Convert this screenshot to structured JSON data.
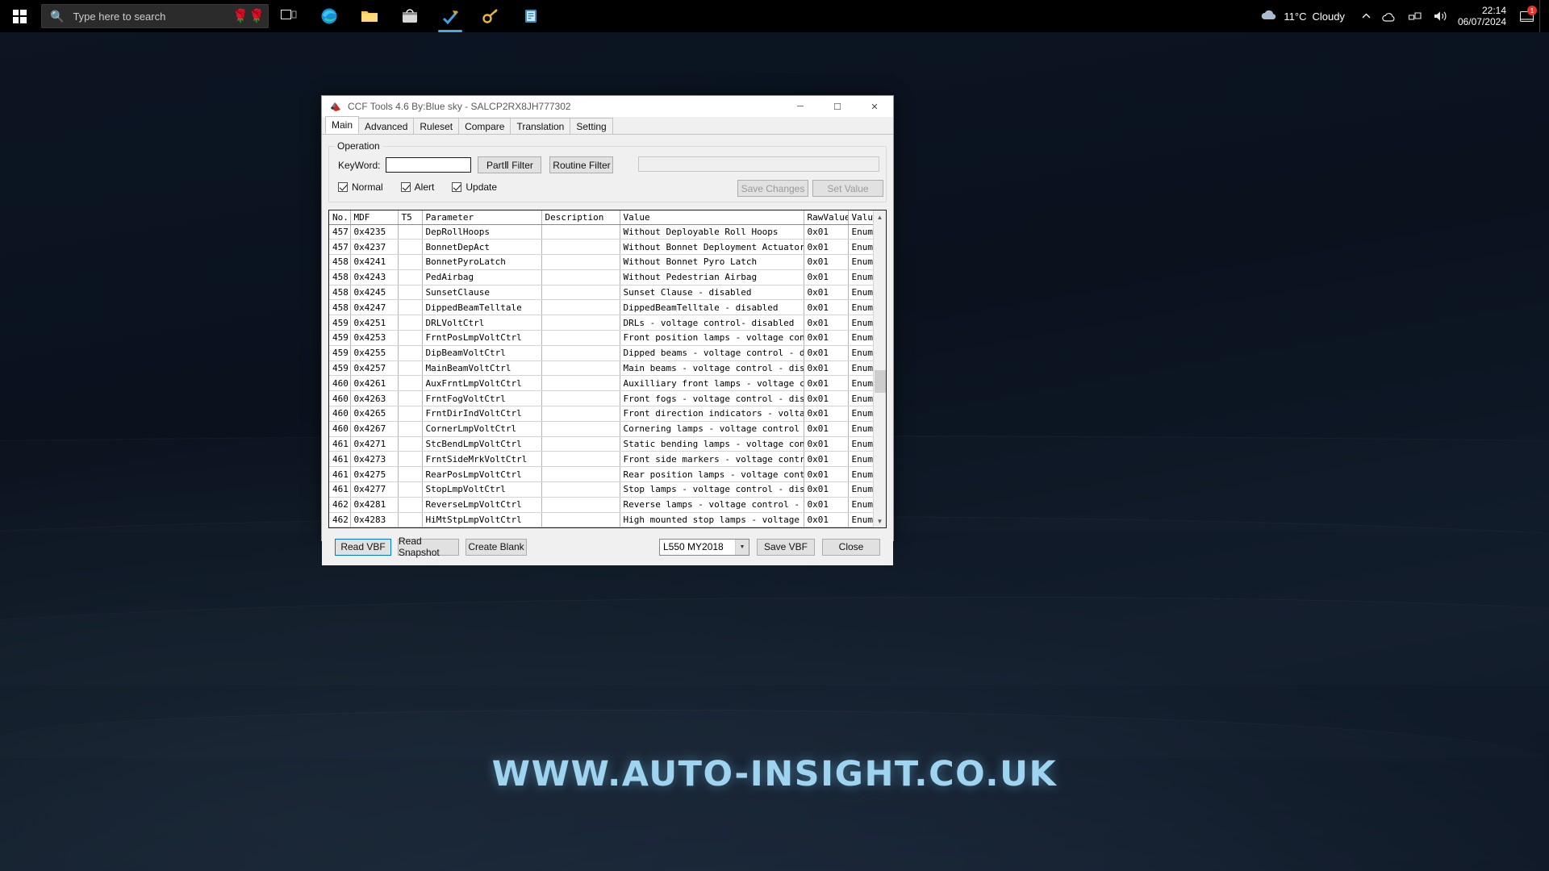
{
  "taskbar": {
    "start_icon": "windows-logo-icon",
    "search_placeholder": "Type here to search",
    "search_value": "",
    "search_icon": "search-icon",
    "decor_icon": "rose-icon",
    "pinned": [
      {
        "name": "task-view-icon",
        "glyph": "▢"
      },
      {
        "name": "microsoft-edge-icon",
        "glyph": "e"
      },
      {
        "name": "file-explorer-icon",
        "glyph": "🗀"
      },
      {
        "name": "microsoft-store-icon",
        "glyph": "🛍"
      },
      {
        "name": "app-pinned-icon-1",
        "glyph": "✓"
      },
      {
        "name": "app-pinned-icon-2",
        "glyph": "🔑"
      },
      {
        "name": "app-pinned-icon-3",
        "glyph": "📋"
      }
    ],
    "weather_temp": "11°C",
    "weather_desc": "Cloudy",
    "weather_icon": "cloud-icon",
    "tray_icons": [
      {
        "name": "show-hidden-icons-chevron",
        "glyph": "⌃"
      },
      {
        "name": "onedrive-icon",
        "glyph": "☁"
      },
      {
        "name": "network-icon",
        "glyph": "🖧"
      },
      {
        "name": "volume-icon",
        "glyph": "🔊"
      }
    ],
    "notification_badge": "1",
    "clock_time": "22:14",
    "clock_date": "06/07/2024"
  },
  "desktop": {
    "watermark": "WWW.AUTO-INSIGHT.CO.UK"
  },
  "window": {
    "title": "CCF Tools 4.6  By:Blue sky - SALCP2RX8JH777302",
    "app_icon": "ccf-tools-icon",
    "minimize": "─",
    "maximize": "☐",
    "close": "✕"
  },
  "tabs": [
    {
      "label": "Main",
      "selected": true
    },
    {
      "label": "Advanced",
      "selected": false
    },
    {
      "label": "Ruleset",
      "selected": false
    },
    {
      "label": "Compare",
      "selected": false
    },
    {
      "label": "Translation",
      "selected": false
    },
    {
      "label": "Setting",
      "selected": false
    }
  ],
  "operation": {
    "legend": "Operation",
    "keyword_label": "KeyWord:",
    "keyword_value": "",
    "keyword_placeholder": "",
    "partii_filter": "PartⅡ Filter",
    "routine_filter": "Routine Filter",
    "status_value": "",
    "save_changes": "Save Changes",
    "set_value": "Set Value",
    "checkboxes": [
      {
        "label": "Normal",
        "checked": true
      },
      {
        "label": "Alert",
        "checked": true
      },
      {
        "label": "Update",
        "checked": true
      }
    ]
  },
  "grid": {
    "columns": [
      "No.",
      "MDF",
      "T5",
      "Parameter",
      "Description",
      "Value",
      "RawValue",
      "ValueType"
    ],
    "rows": [
      [
        "457",
        "0x4235",
        "",
        "DepRollHoops",
        "",
        "Without Deployable Roll Hoops",
        "0x01",
        "Enumerated"
      ],
      [
        "457",
        "0x4237",
        "",
        "BonnetDepAct",
        "",
        "Without Bonnet Deployment Actuator",
        "0x01",
        "Enumerated"
      ],
      [
        "458",
        "0x4241",
        "",
        "BonnetPyroLatch",
        "",
        "Without Bonnet Pyro Latch",
        "0x01",
        "Enumerated"
      ],
      [
        "458",
        "0x4243",
        "",
        "PedAirbag",
        "",
        "Without Pedestrian Airbag",
        "0x01",
        "Enumerated"
      ],
      [
        "458",
        "0x4245",
        "",
        "SunsetClause",
        "",
        "Sunset Clause - disabled",
        "0x01",
        "Enumerated"
      ],
      [
        "458",
        "0x4247",
        "",
        "DippedBeamTelltale",
        "",
        "DippedBeamTelltale - disabled",
        "0x01",
        "Enumerated"
      ],
      [
        "459",
        "0x4251",
        "",
        "DRLVoltCtrl",
        "",
        "DRLs - voltage control- disabled",
        "0x01",
        "Enumerated"
      ],
      [
        "459",
        "0x4253",
        "",
        "FrntPosLmpVoltCtrl",
        "",
        "Front position lamps - voltage control - d...",
        "0x01",
        "Enumerated"
      ],
      [
        "459",
        "0x4255",
        "",
        "DipBeamVoltCtrl",
        "",
        "Dipped beams - voltage control - disabled",
        "0x01",
        "Enumerated"
      ],
      [
        "459",
        "0x4257",
        "",
        "MainBeamVoltCtrl",
        "",
        "Main beams - voltage control - disabled",
        "0x01",
        "Enumerated"
      ],
      [
        "460",
        "0x4261",
        "",
        "AuxFrntLmpVoltCtrl",
        "",
        "Auxilliary front lamps - voltage control -...",
        "0x01",
        "Enumerated"
      ],
      [
        "460",
        "0x4263",
        "",
        "FrntFogVoltCtrl",
        "",
        "Front fogs - voltage control - disabled",
        "0x01",
        "Enumerated"
      ],
      [
        "460",
        "0x4265",
        "",
        "FrntDirIndVoltCtrl",
        "",
        "Front direction indicators - voltage contr...",
        "0x01",
        "Enumerated"
      ],
      [
        "460",
        "0x4267",
        "",
        "CornerLmpVoltCtrl",
        "",
        "Cornering lamps - voltage control - disabled",
        "0x01",
        "Enumerated"
      ],
      [
        "461",
        "0x4271",
        "",
        "StcBendLmpVoltCtrl",
        "",
        "Static bending lamps - voltage control - d...",
        "0x01",
        "Enumerated"
      ],
      [
        "461",
        "0x4273",
        "",
        "FrntSideMrkVoltCtrl",
        "",
        "Front side markers - voltage control - dis...",
        "0x01",
        "Enumerated"
      ],
      [
        "461",
        "0x4275",
        "",
        "RearPosLmpVoltCtrl",
        "",
        "Rear position lamps - voltage control - di...",
        "0x01",
        "Enumerated"
      ],
      [
        "461",
        "0x4277",
        "",
        "StopLmpVoltCtrl",
        "",
        "Stop lamps - voltage control - disabled",
        "0x01",
        "Enumerated"
      ],
      [
        "462",
        "0x4281",
        "",
        "ReverseLmpVoltCtrl",
        "",
        "Reverse lamps - voltage control - disabled",
        "0x01",
        "Enumerated"
      ],
      [
        "462",
        "0x4283",
        "",
        "HiMtStpLmpVoltCtrl",
        "",
        "High mounted stop lamps - voltage control ...",
        "0x01",
        "Enumerated"
      ]
    ]
  },
  "bottom": {
    "read_vbf": "Read VBF",
    "read_snapshot": "Read Snapshot",
    "create_blank": "Create Blank",
    "model_value": "L550 MY2018",
    "save_vbf": "Save VBF",
    "close": "Close"
  },
  "colors": {
    "accent": "#0078d7",
    "window_bg": "#f0f0f0",
    "taskbar_bg": "#000000",
    "watermark": "#9fd4f0"
  }
}
